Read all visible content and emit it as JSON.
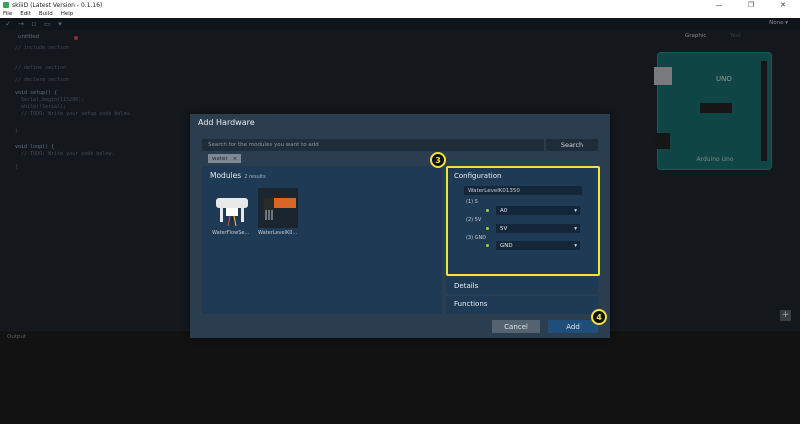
{
  "window": {
    "title": "skiiiD (Latest Version - 0.1.16)",
    "minimize_glyph": "—",
    "maximize_glyph": "❐",
    "close_glyph": "✕"
  },
  "menu": [
    "File",
    "Edit",
    "Build",
    "Help"
  ],
  "toolbar": {
    "user_name": "None ▾"
  },
  "editor": {
    "tab_name": "untitled",
    "lines": [
      "// include section",
      "",
      "// define section",
      "",
      "// declare section",
      "",
      "void setup() {",
      "  Serial.begin(115200);",
      "  while(!Serial);",
      "  // TODO: Write your setup code below.",
      "",
      "}",
      "",
      "void loop() {",
      "  // TODO: Write your code below.",
      "",
      "}"
    ]
  },
  "right_panel": {
    "graphic_tab": "Graphic",
    "text_tab": "Text",
    "board_name": "Arduino Uno",
    "board_mark": "UNO"
  },
  "output": {
    "label": "Output"
  },
  "dialog": {
    "title": "Add Hardware",
    "search_placeholder": "Search for the modules you want to add",
    "search_button": "Search",
    "filter_chip": "water",
    "filter_chip_close": "×",
    "modules_header": "Modules",
    "modules_count": "2 results",
    "modules": [
      {
        "name": "WaterFlowSe..."
      },
      {
        "name": "WaterLevelK0..."
      }
    ],
    "config": {
      "header": "Configuration",
      "module_name": "WaterLevelK01350",
      "pins": [
        {
          "label": "(1) S",
          "value": "A0"
        },
        {
          "label": "(2) 5V",
          "value": "5V"
        },
        {
          "label": "(3) GND",
          "value": "GND"
        }
      ]
    },
    "details_header": "Details",
    "functions_header": "Functions",
    "cancel_button": "Cancel",
    "add_button": "Add"
  },
  "annotations": {
    "step_config": "3",
    "step_add": "4"
  },
  "colors": {
    "highlight": "#f2e23c",
    "pin_dot": "#9cd23a",
    "accent": "#1f4e7a"
  }
}
